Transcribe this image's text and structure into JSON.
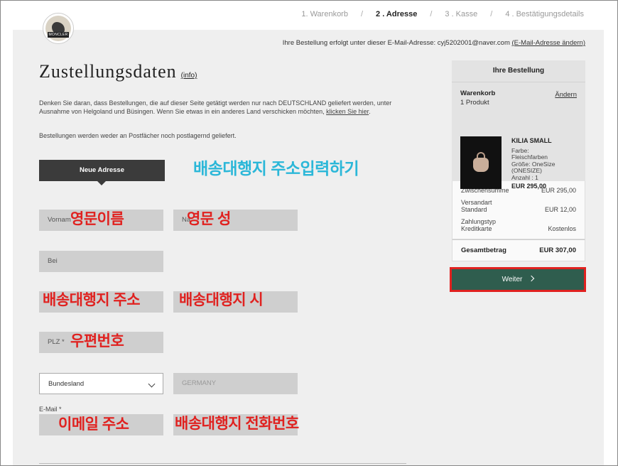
{
  "logo": {
    "text": "MONCLER"
  },
  "steps": [
    {
      "label": "1. Warenkorb"
    },
    {
      "label": "2 . Adresse"
    },
    {
      "label": "3 . Kasse"
    },
    {
      "label": "4 . Bestätigungsdetails"
    }
  ],
  "step_separator": "/",
  "email_notice": {
    "text": "Ihre Bestellung erfolgt unter dieser E-Mail-Adresse: cyj5202001@naver.com",
    "change_link": "(E-Mail-Adresse ändern)"
  },
  "page": {
    "title": "Zustellungsdaten",
    "info_link": "(info)",
    "note_text": "Denken Sie daran, dass Bestellungen, die auf dieser Seite getätigt werden nur nach DEUTSCHLAND geliefert werden, unter Ausnahme von Helgoland und Büsingen. Wenn Sie etwas in ein anderes Land verschicken möchten,",
    "note_link": "klicken Sie hier",
    "note_end": ".",
    "note2": "Bestellungen werden weder an Postfächer noch postlagernd geliefert."
  },
  "address_tab": {
    "label": "Neue Adresse"
  },
  "form": {
    "vorname_placeholder": "Vornam",
    "nachname_placeholder": "Na",
    "bei_placeholder": "Bei",
    "plz_placeholder": "PLZ *",
    "bundesland_value": "Bundesland",
    "country_value": "GERMANY",
    "email_label": "E-Mail *"
  },
  "annotations": {
    "title_note": "배송대행지 주소입력하기",
    "first_name": "영문이름",
    "last_name": "영문 성",
    "address": "배송대행지 주소",
    "city": "배송대행지 시",
    "postal": "우편번호",
    "email": "이메일 주소",
    "phone": "배송대행지 전화번호"
  },
  "summary": {
    "header": "Ihre Bestellung",
    "cart_label": "Warenkorb",
    "change_link": "Ändern",
    "product_count": "1 Produkt",
    "product": {
      "name": "KILIA SMALL",
      "color_label": "Farbe:",
      "color_value": "Fleischfarben",
      "size_label": "Größe:",
      "size_value": "OneSize",
      "size_extra": "(ONESIZE)",
      "qty": "Anzahl : 1",
      "price": "EUR 295,00"
    },
    "subtotal_label": "Zwischensumme",
    "subtotal_value": "EUR 295,00",
    "shipping_label1": "Versandart",
    "shipping_label2": "Standard",
    "shipping_value": "EUR 12,00",
    "payment_label1": "Zahlungstyp",
    "payment_label2": "Kreditkarte",
    "payment_value": "Kostenlos",
    "total_label": "Gesamtbetrag",
    "total_value": "EUR 307,00",
    "continue_button": "Weiter"
  },
  "colors": {
    "accent_green": "#2f5d4e",
    "highlight_red": "#e0211f",
    "annotation_cyan": "#2bb7d8"
  }
}
